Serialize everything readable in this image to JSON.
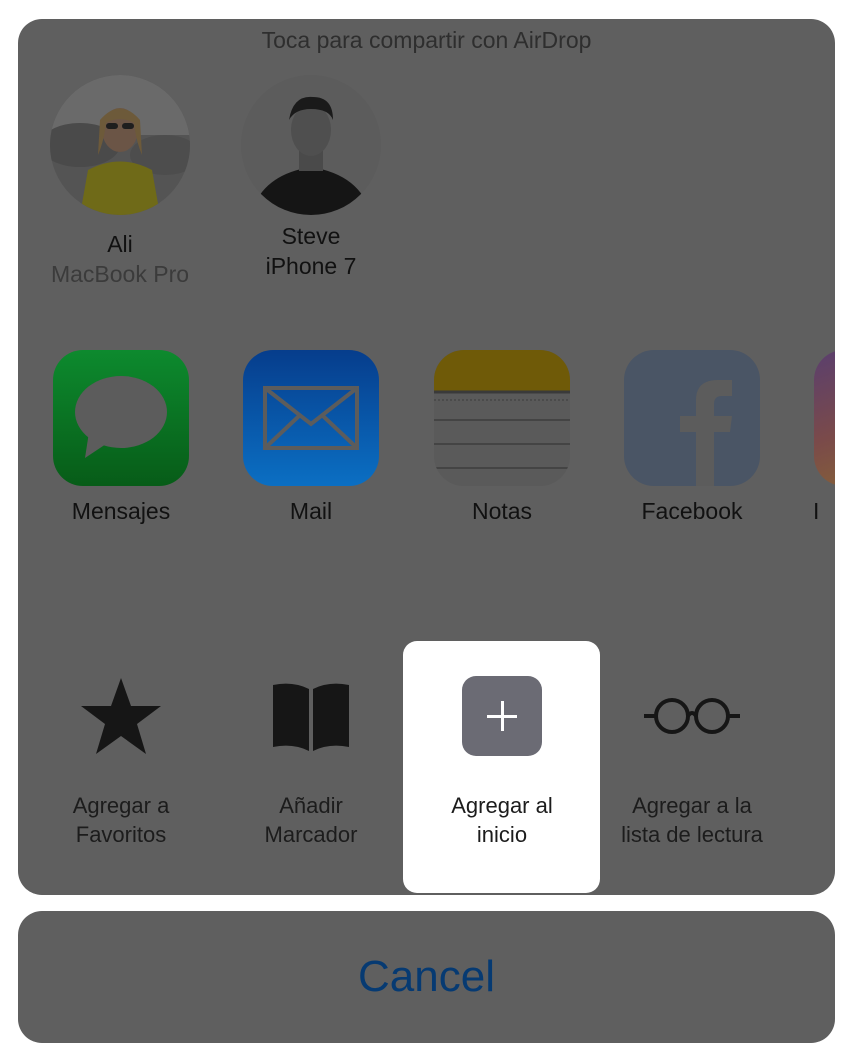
{
  "airdrop": {
    "title": "Toca para compartir con AirDrop",
    "people": [
      {
        "name": "Ali",
        "device": "MacBook Pro"
      },
      {
        "name": "Steve",
        "device": "iPhone 7"
      }
    ]
  },
  "apps": [
    {
      "label": "Mensajes",
      "icon": "messages-icon"
    },
    {
      "label": "Mail",
      "icon": "mail-icon"
    },
    {
      "label": "Notas",
      "icon": "notes-icon"
    },
    {
      "label": "Facebook",
      "icon": "facebook-icon"
    },
    {
      "label": "I",
      "icon": "instagram-icon"
    }
  ],
  "actions": [
    {
      "label_line1": "Agregar a",
      "label_line2": "Favoritos",
      "icon": "star-icon"
    },
    {
      "label_line1": "Añadir",
      "label_line2": "Marcador",
      "icon": "book-icon"
    },
    {
      "label_line1": "Agregar al",
      "label_line2": "inicio",
      "icon": "plus-icon",
      "selected": true
    },
    {
      "label_line1": "Agregar a la",
      "label_line2": "lista de lectura",
      "icon": "glasses-icon"
    }
  ],
  "cancel": {
    "label": "Cancel"
  }
}
